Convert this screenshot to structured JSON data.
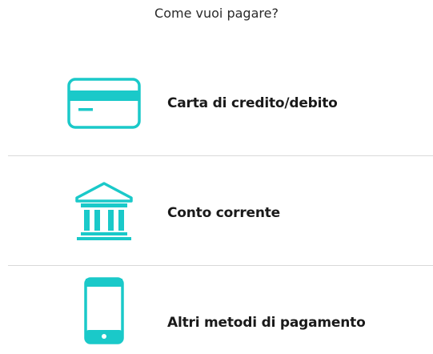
{
  "header": {
    "title": "Come vuoi pagare?"
  },
  "accent_color": "#1ac9c9",
  "payment_options": [
    {
      "label": "Carta di credito/debito",
      "icon": "credit-card-icon"
    },
    {
      "label": "Conto corrente",
      "icon": "bank-icon"
    },
    {
      "label": "Altri metodi di pagamento",
      "icon": "smartphone-icon"
    }
  ]
}
